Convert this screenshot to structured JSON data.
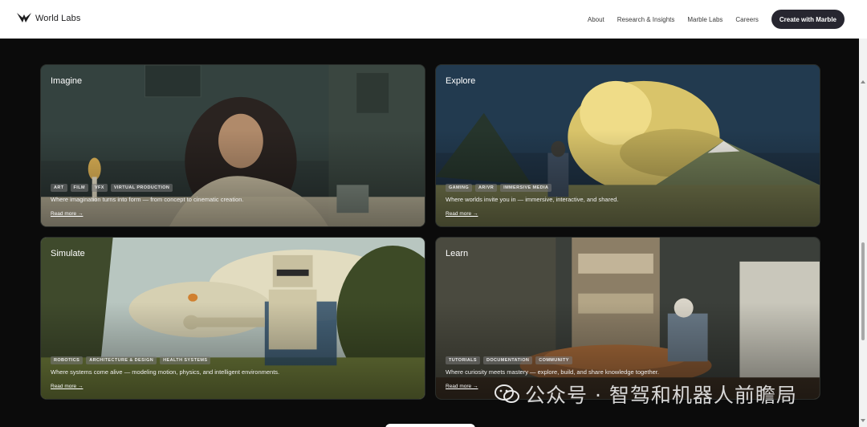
{
  "header": {
    "logo_text": "World Labs",
    "nav": [
      "About",
      "Research & Insights",
      "Marble Labs",
      "Careers"
    ],
    "cta": "Create with Marble"
  },
  "cards": [
    {
      "title": "Imagine",
      "tags": [
        "ART",
        "FILM",
        "VFX",
        "VIRTUAL PRODUCTION"
      ],
      "description": "Where imagination turns into form — from concept to cinematic creation.",
      "read_more": "Read more →"
    },
    {
      "title": "Explore",
      "tags": [
        "GAMING",
        "AR/VR",
        "IMMERSIVE MEDIA"
      ],
      "description": "Where worlds invite you in — immersive, interactive, and shared.",
      "read_more": "Read more →"
    },
    {
      "title": "Simulate",
      "tags": [
        "ROBOTICS",
        "ARCHITECTURE & DESIGN",
        "HEALTH SYSTEMS"
      ],
      "description": "Where systems come alive — modeling motion, physics, and intelligent environments.",
      "read_more": "Read more →"
    },
    {
      "title": "Learn",
      "tags": [
        "TUTORIALS",
        "DOCUMENTATION",
        "COMMUNITY"
      ],
      "description": "Where curiosity meets mastery — explore, build, and share knowledge together.",
      "read_more": "Read more →"
    }
  ],
  "watermark": {
    "text": "公众号 · 智驾和机器人前瞻局"
  },
  "colors": {
    "header_bg": "#ffffff",
    "page_bg": "#0b0b0b",
    "cta_bg": "#272630",
    "tag_bg": "#787878"
  }
}
